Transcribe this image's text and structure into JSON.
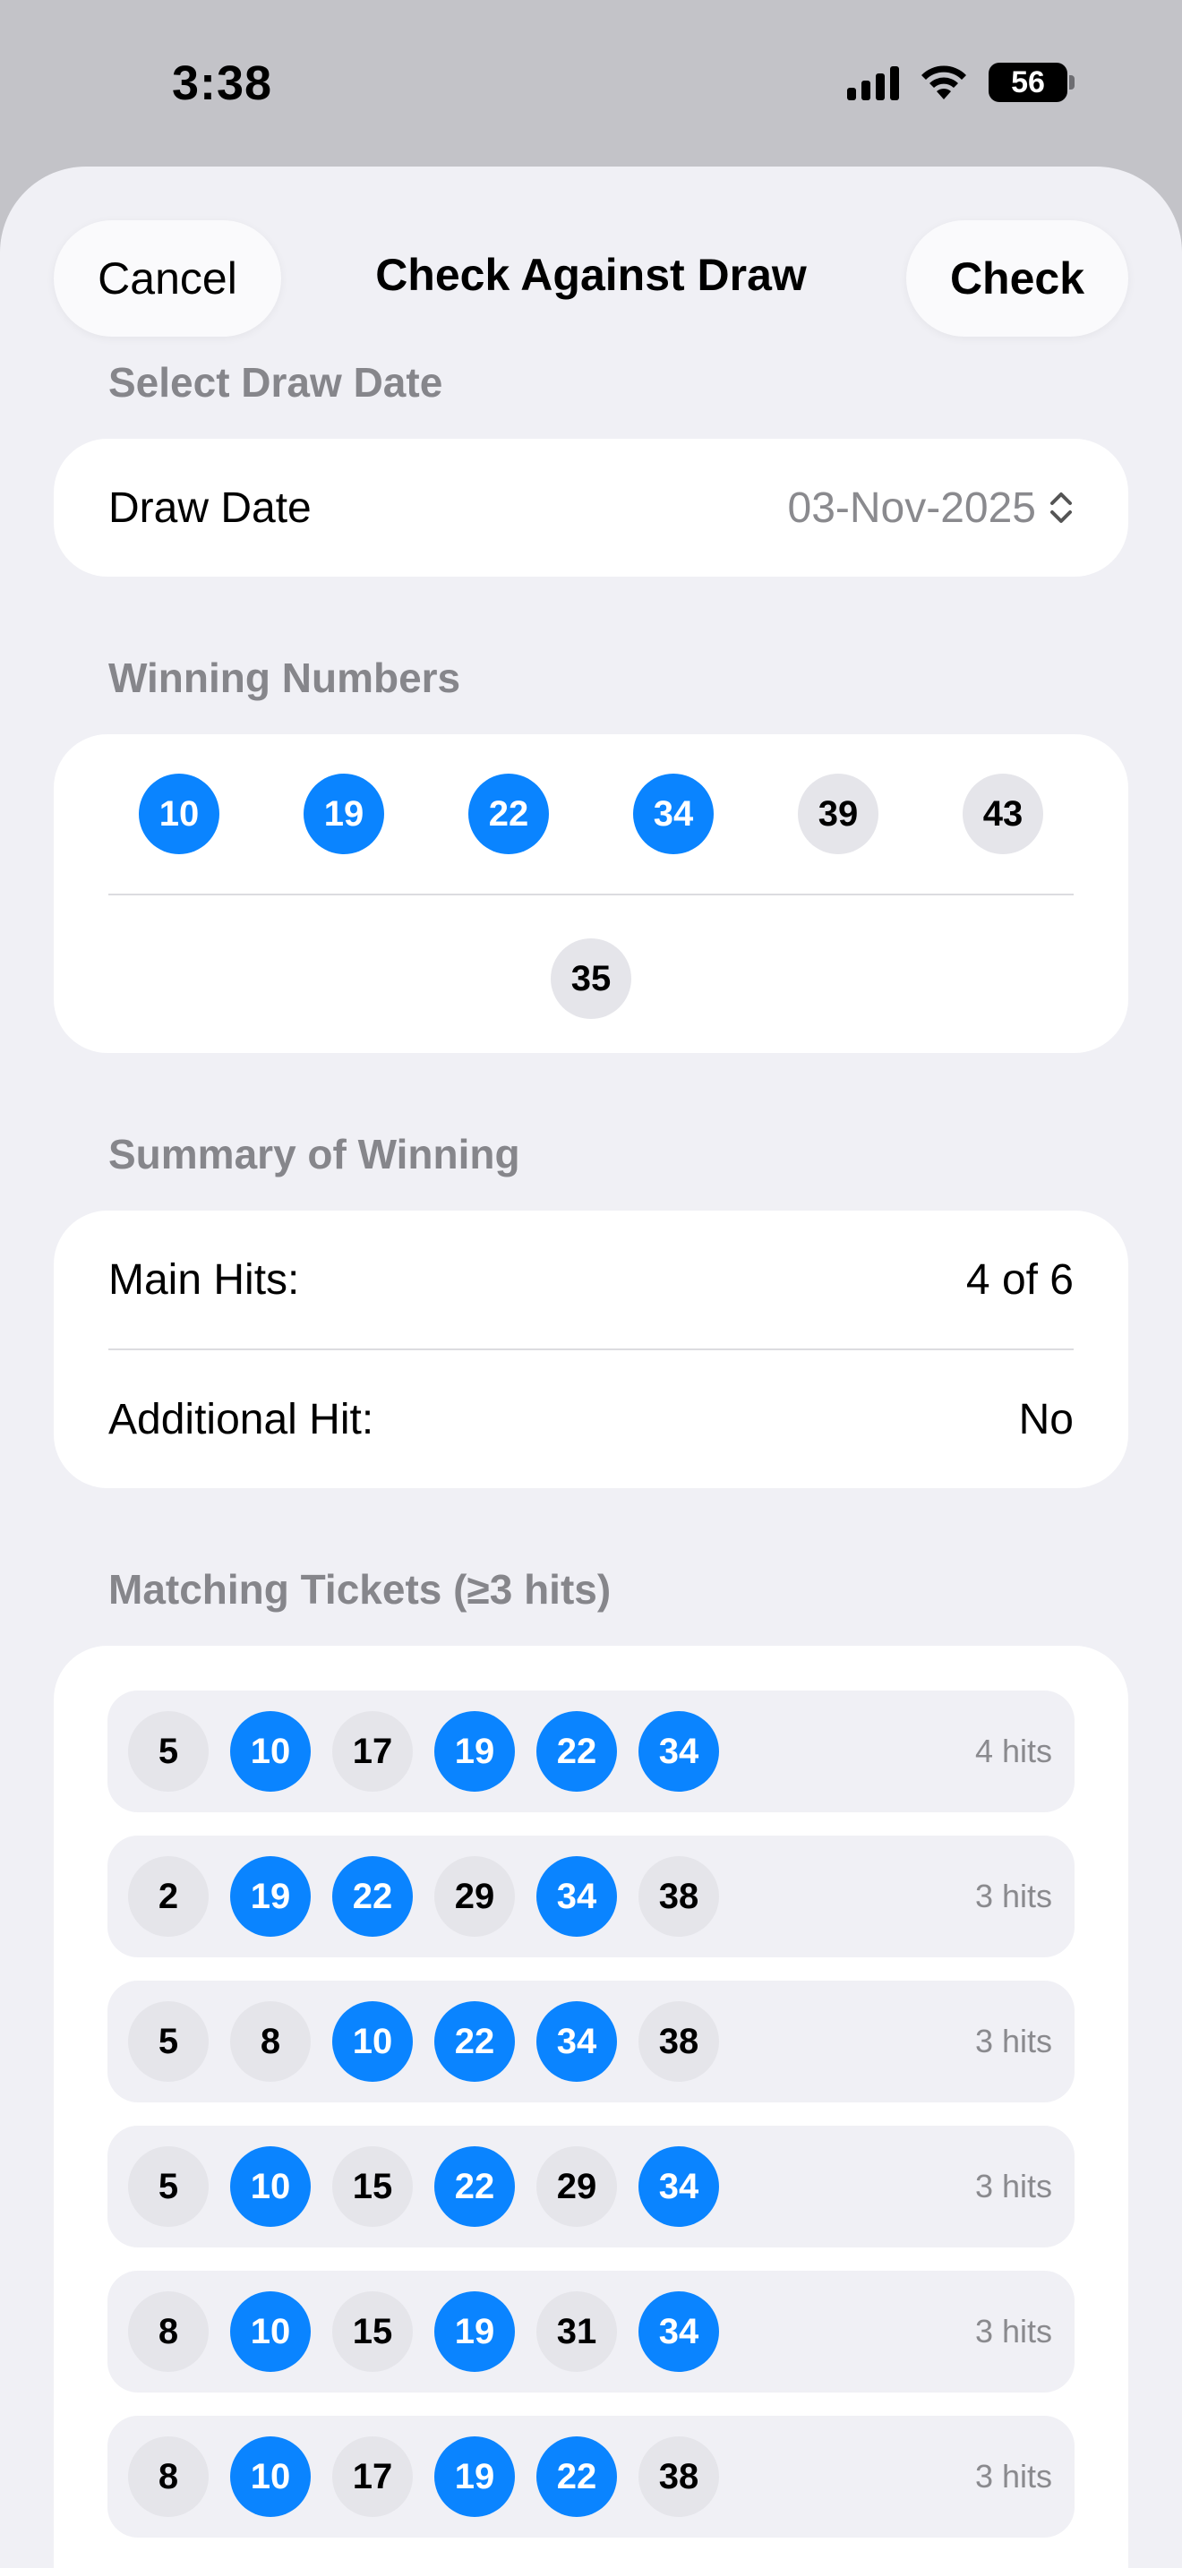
{
  "status": {
    "time": "3:38",
    "battery": "56"
  },
  "nav": {
    "cancel": "Cancel",
    "title": "Check Against Draw",
    "check": "Check"
  },
  "draw_date": {
    "header": "Select Draw Date",
    "label": "Draw Date",
    "value": "03-Nov-2025"
  },
  "winning": {
    "header": "Winning Numbers",
    "main": [
      {
        "n": "10",
        "hit": true
      },
      {
        "n": "19",
        "hit": true
      },
      {
        "n": "22",
        "hit": true
      },
      {
        "n": "34",
        "hit": true
      },
      {
        "n": "39",
        "hit": false
      },
      {
        "n": "43",
        "hit": false
      }
    ],
    "additional": "35"
  },
  "summary": {
    "header": "Summary of Winning",
    "main_label": "Main Hits:",
    "main_value": "4 of 6",
    "add_label": "Additional Hit:",
    "add_value": "No"
  },
  "tickets": {
    "header": "Matching Tickets (≥3 hits)",
    "hit_numbers": [
      "10",
      "19",
      "22",
      "34"
    ],
    "rows": [
      {
        "numbers": [
          "5",
          "10",
          "17",
          "19",
          "22",
          "34"
        ],
        "hits": "4 hits"
      },
      {
        "numbers": [
          "2",
          "19",
          "22",
          "29",
          "34",
          "38"
        ],
        "hits": "3 hits"
      },
      {
        "numbers": [
          "5",
          "8",
          "10",
          "22",
          "34",
          "38"
        ],
        "hits": "3 hits"
      },
      {
        "numbers": [
          "5",
          "10",
          "15",
          "22",
          "29",
          "34"
        ],
        "hits": "3 hits"
      },
      {
        "numbers": [
          "8",
          "10",
          "15",
          "19",
          "31",
          "34"
        ],
        "hits": "3 hits"
      },
      {
        "numbers": [
          "8",
          "10",
          "17",
          "19",
          "22",
          "38"
        ],
        "hits": "3 hits"
      }
    ]
  },
  "colors": {
    "accent": "#0a84ff",
    "ball": "#e5e5ea",
    "sheet": "#f0f0f5"
  }
}
